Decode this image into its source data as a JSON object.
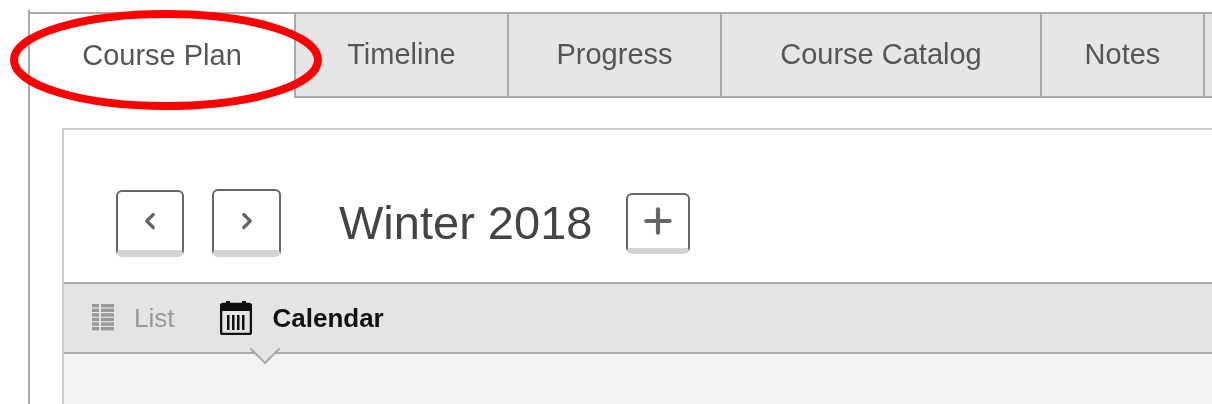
{
  "tabs": [
    {
      "label": "Course Plan",
      "selected": true,
      "circled": true
    },
    {
      "label": "Timeline",
      "selected": false,
      "circled": false
    },
    {
      "label": "Progress",
      "selected": false,
      "circled": false
    },
    {
      "label": "Course Catalog",
      "selected": false,
      "circled": false
    },
    {
      "label": "Notes",
      "selected": false,
      "circled": false
    }
  ],
  "term": {
    "title": "Winter 2018"
  },
  "views": [
    {
      "kind": "list",
      "label": "List",
      "selected": false
    },
    {
      "kind": "calendar",
      "label": "Calendar",
      "selected": true
    }
  ]
}
